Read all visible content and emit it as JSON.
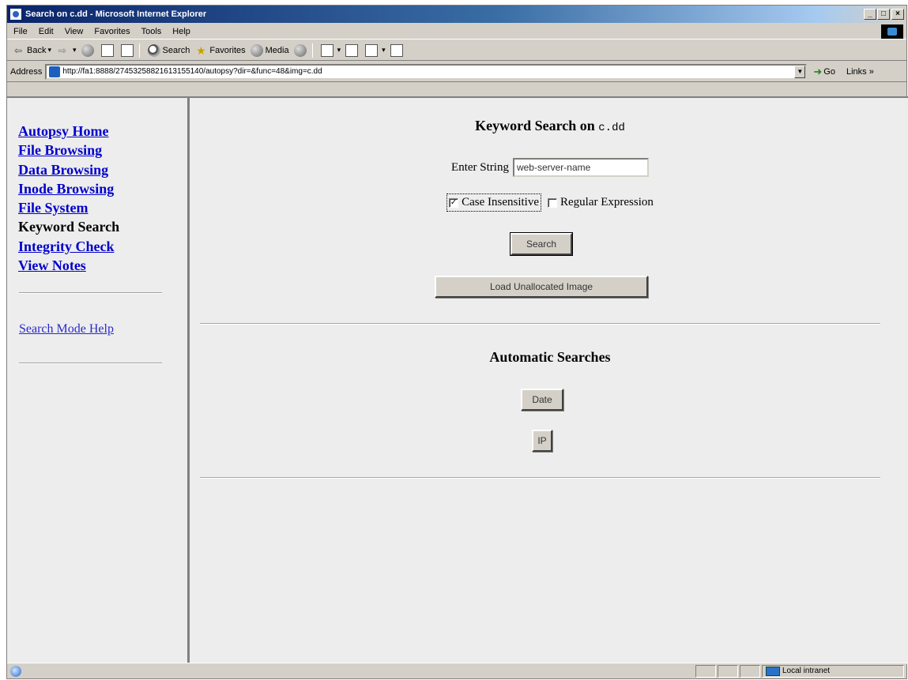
{
  "window": {
    "title": "Search on c.dd - Microsoft Internet Explorer",
    "controls": {
      "minimize": "_",
      "maximize": "□",
      "close": "×"
    }
  },
  "menu": [
    "File",
    "Edit",
    "View",
    "Favorites",
    "Tools",
    "Help"
  ],
  "toolbar": {
    "back": "Back",
    "search": "Search",
    "favorites": "Favorites",
    "media": "Media"
  },
  "address": {
    "label": "Address",
    "url": "http://fa1:8888/27453258821613155140/autopsy?dir=&func=48&img=c.dd",
    "go": "Go",
    "links": "Links »"
  },
  "sidebar": {
    "nav": [
      {
        "label": "Autopsy Home",
        "current": false
      },
      {
        "label": "File Browsing",
        "current": false
      },
      {
        "label": "Data Browsing",
        "current": false
      },
      {
        "label": "Inode Browsing",
        "current": false
      },
      {
        "label": "File System",
        "current": false
      },
      {
        "label": "Keyword Search",
        "current": true
      },
      {
        "label": "Integrity Check",
        "current": false
      },
      {
        "label": "View Notes",
        "current": false
      }
    ],
    "help_link": "Search Mode Help"
  },
  "main": {
    "heading_prefix": "Keyword Search on",
    "image_name": "c.dd",
    "enter_label": "Enter String",
    "search_value": "web-server-name",
    "case_insensitive_label": "Case Insensitive",
    "case_insensitive_checked": true,
    "regex_label": "Regular Expression",
    "regex_checked": false,
    "search_button": "Search",
    "load_unalloc_button": "Load Unallocated Image",
    "auto_heading": "Automatic Searches",
    "date_button": "Date",
    "ip_button": "IP"
  },
  "status": {
    "zone": "Local intranet"
  }
}
